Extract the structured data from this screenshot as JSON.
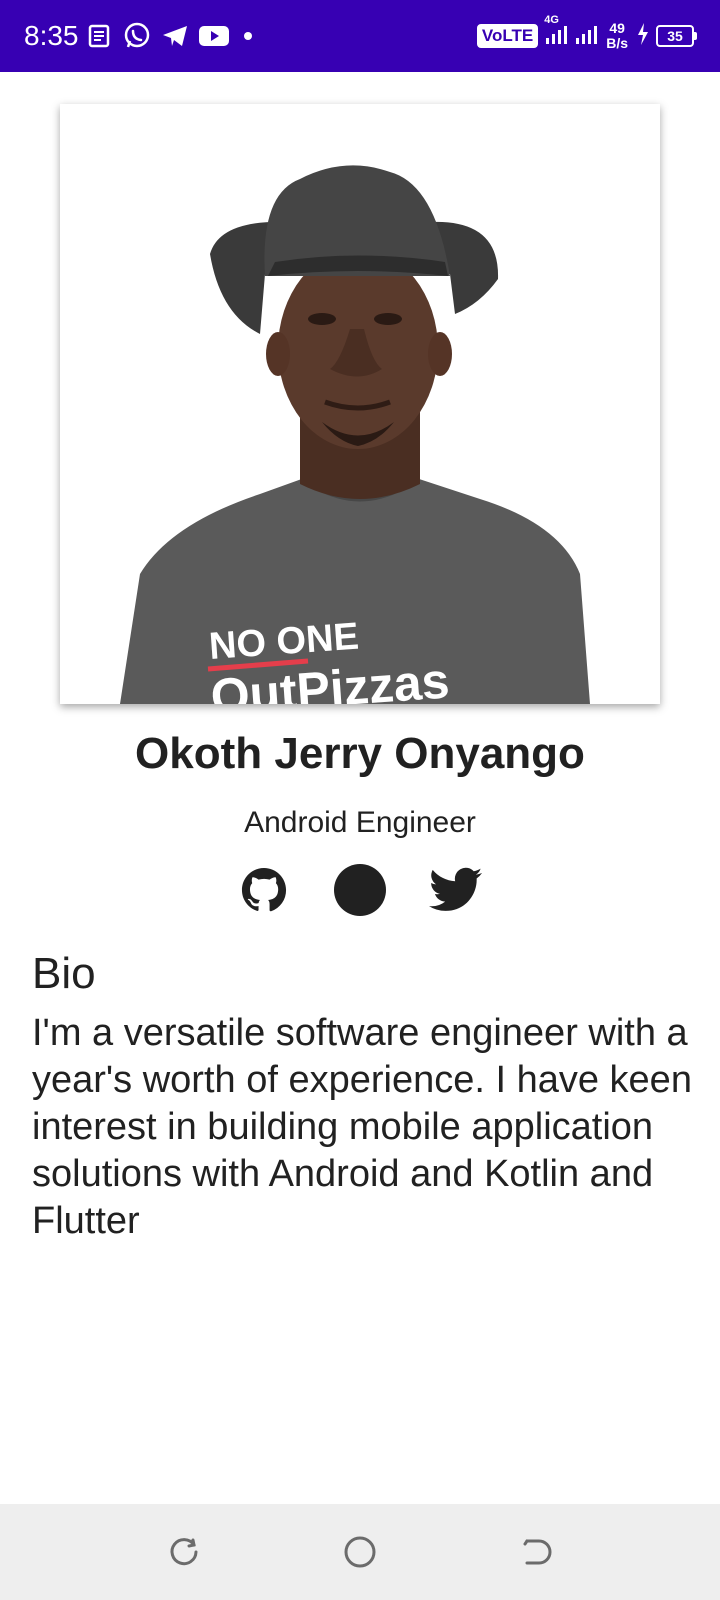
{
  "status_bar": {
    "time": "8:35",
    "volte": "VoLTE",
    "network": "4G",
    "speed_value": "49",
    "speed_unit": "B/s",
    "battery": "35",
    "color": "#3700b3",
    "left_icons": [
      "news-icon",
      "whatsapp-icon",
      "telegram-icon",
      "youtube-icon",
      "dot-icon"
    ],
    "right_icons": [
      "signal-icon",
      "signal-icon",
      "charging-icon",
      "battery-icon"
    ]
  },
  "profile": {
    "photo_shirt_text_1": "NO ONE",
    "photo_shirt_text_2": "OutPizzas",
    "name": "Okoth Jerry Onyango",
    "role": "Android Engineer",
    "social_icons": [
      "github-icon",
      "slack-icon",
      "twitter-icon"
    ]
  },
  "bio": {
    "title": "Bio",
    "text": "I'm a versatile software engineer with a year's worth of experience. I have keen interest in building mobile application solutions with Android and Kotlin and Flutter"
  },
  "nav_bar": {
    "icons": [
      "recents-icon",
      "home-icon",
      "back-icon"
    ],
    "background": "#eeeeee"
  }
}
